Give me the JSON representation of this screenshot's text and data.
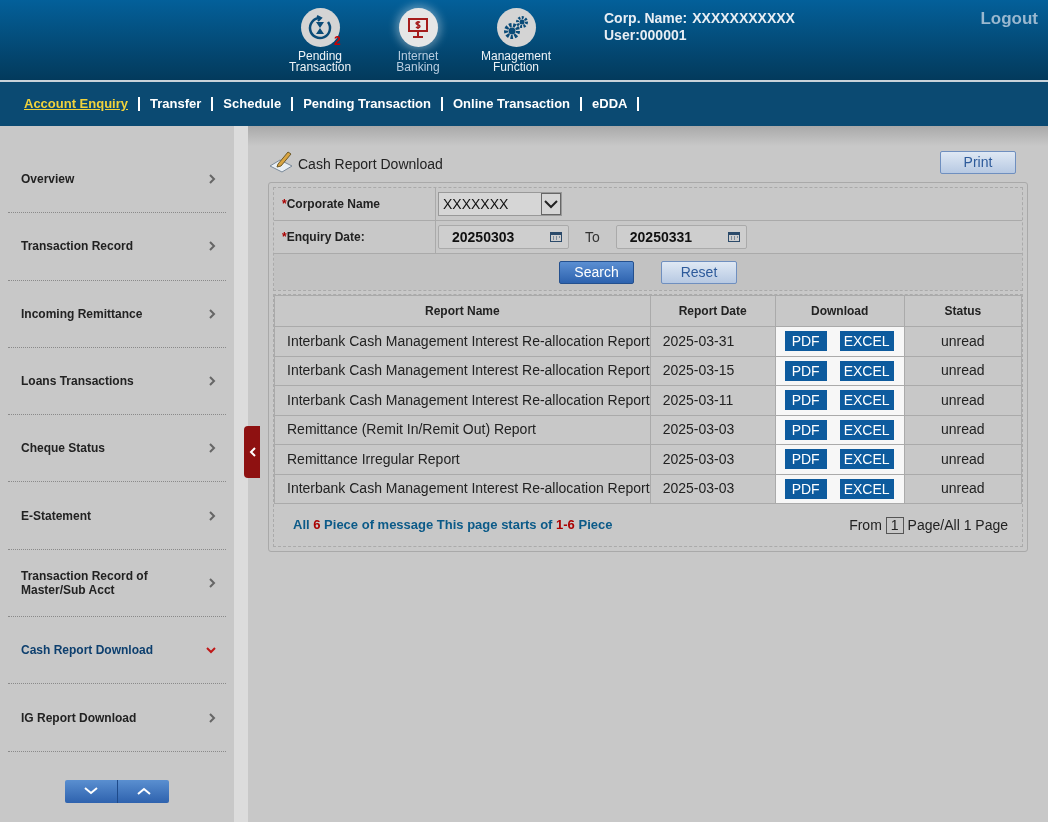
{
  "header": {
    "shortcuts": [
      {
        "kind": "pending",
        "label": "Pending Transaction",
        "badge": "2",
        "selected": false
      },
      {
        "kind": "banking",
        "label": "Internet Banking",
        "selected": true
      },
      {
        "kind": "management",
        "label": "Management Function",
        "selected": false
      }
    ],
    "corp_name_label": "Corp. Name:",
    "corp_name": "XXXXXXXXXXX",
    "user": "User:000001",
    "logout": "Logout"
  },
  "nav": {
    "tabs": [
      {
        "label": "Account Enquiry",
        "selected": true
      },
      {
        "label": "Transfer",
        "selected": false
      },
      {
        "label": "Schedule",
        "selected": false
      },
      {
        "label": "Pending Transaction",
        "selected": false
      },
      {
        "label": "Online Transaction",
        "selected": false
      },
      {
        "label": "eDDA",
        "selected": false
      }
    ]
  },
  "sidebar": {
    "items": [
      {
        "label": "Overview",
        "selected": false
      },
      {
        "label": "Transaction Record",
        "selected": false
      },
      {
        "label": "Incoming Remittance",
        "selected": false
      },
      {
        "label": "Loans Transactions",
        "selected": false
      },
      {
        "label": "Cheque Status",
        "selected": false
      },
      {
        "label": "E-Statement",
        "selected": false
      },
      {
        "label": "Transaction Record of Master/Sub Acct",
        "selected": false
      },
      {
        "label": "Cash Report Download",
        "selected": true
      },
      {
        "label": "IG Report Download",
        "selected": false
      }
    ]
  },
  "page": {
    "title": "Cash Report Download",
    "print": "Print",
    "form": {
      "corporate_label": "Corporate Name",
      "corporate_value": "XXXXXXX",
      "date_label": "Enquiry Date:",
      "date_from": "20250303",
      "to": "To",
      "date_to": "20250331",
      "required_mark": "*",
      "search": "Search",
      "reset": "Reset"
    },
    "table": {
      "columns": [
        "Report Name",
        "Report Date",
        "Download",
        "Status"
      ],
      "rows": [
        {
          "name": "Interbank Cash Management Interest Re-allocation Report",
          "date": "2025-03-31",
          "downloads": [
            "PDF",
            "EXCEL"
          ],
          "status": "unread"
        },
        {
          "name": "Interbank Cash Management Interest Re-allocation Report",
          "date": "2025-03-15",
          "downloads": [
            "PDF",
            "EXCEL"
          ],
          "status": "unread"
        },
        {
          "name": "Interbank Cash Management Interest Re-allocation Report",
          "date": "2025-03-11",
          "downloads": [
            "PDF",
            "EXCEL"
          ],
          "status": "unread"
        },
        {
          "name": "Remittance (Remit In/Remit Out) Report",
          "date": "2025-03-03",
          "downloads": [
            "PDF",
            "EXCEL"
          ],
          "status": "unread"
        },
        {
          "name": "Remittance Irregular Report",
          "date": "2025-03-03",
          "downloads": [
            "PDF",
            "EXCEL"
          ],
          "status": "unread"
        },
        {
          "name": "Interbank Cash Management Interest Re-allocation Report",
          "date": "2025-03-03",
          "downloads": [
            "PDF",
            "EXCEL"
          ],
          "status": "unread"
        }
      ]
    },
    "summary": {
      "prefix": "All",
      "total": "6",
      "middle": "Piece of message This page starts of",
      "range": "1-6",
      "suffix": "Piece"
    },
    "pager": {
      "from": "From",
      "page": "1",
      "rest": "Page/All 1 Page"
    }
  }
}
